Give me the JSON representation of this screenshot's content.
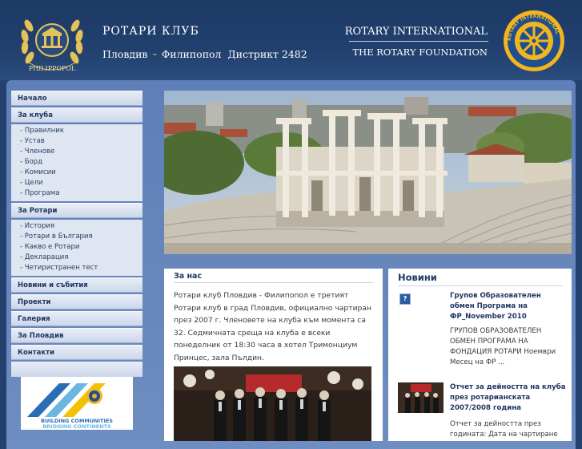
{
  "header": {
    "club_title": "РОТАРИ КЛУБ",
    "city_left": "Пловдив",
    "city_right": "Филипопол",
    "district": "Дистрикт 2482",
    "logo_left_text": "PHILIPPOPOL",
    "ri_title": "ROTARY INTERNATIONAL",
    "rf_title": "THE ROTARY FOUNDATION",
    "ri_logo_text": "ROTARY INTERNATIONAL"
  },
  "sidebar": {
    "home": "Начало",
    "about_club": "За клуба",
    "about_club_items": [
      "- Правилник",
      "- Устав",
      "- Членове",
      "- Борд",
      "- Комисии",
      "- Цели",
      "- Програма"
    ],
    "about_rotary": "За Ротари",
    "about_rotary_items": [
      "- История",
      "- Ротари в България",
      "- Какво е Ротари",
      "- Декларация",
      "- Четиристранен тест"
    ],
    "news": "Новини и събития",
    "projects": "Проекти",
    "gallery": "Галерия",
    "plovdiv": "За Пловдив",
    "contacts": "Контакти"
  },
  "banner": {
    "line1": "BUILDING COMMUNITIES",
    "line2": "BRIDGING CONTINENTS"
  },
  "about": {
    "title": "За нас",
    "text": "Ротари клуб Пловдив - Филипопол е третият Ротари клуб в град Пловдив, официално чартиран през 2007 г. Членовете на клуба към момента са 32. Седмичната среща на клуба е всеки понеделник от 18:30 часа в хотел Тримонциум Принцес, зала Пълдин."
  },
  "news": {
    "title": "Новини",
    "item1_title": "Групов Образователен обмен Програма на ФР_November 2010",
    "item1_text": "ГРУПОВ ОБРАЗОВАТЕЛЕН ОБМЕН ПРОГРАМА НА ФОНДАЦИЯ РОТАРИ Ноември Месец на ФР ...",
    "item2_title": "Отчет за дейността на клуба през ротарианската 2007/2008 година",
    "item2_text": "Отчет за дейността през годината: Дата на чартиране"
  },
  "colors": {
    "header_bg": "#21406e",
    "frame_bg": "#6a8abe",
    "heading": "#1f3763",
    "gold": "#e8c25a"
  }
}
